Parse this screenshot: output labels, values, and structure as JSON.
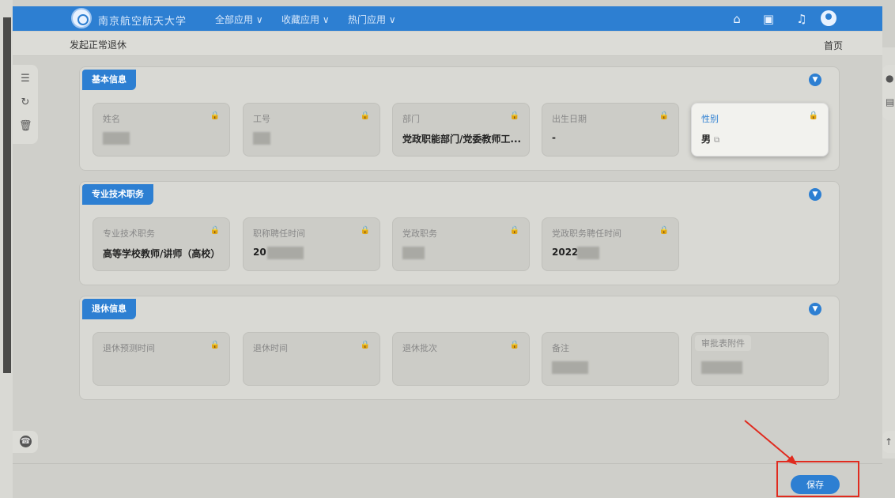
{
  "topbar": {
    "school_name": "南京航空航天大学",
    "menus": [
      "全部应用 ∨",
      "收藏应用 ∨",
      "热门应用 ∨"
    ],
    "colors": {
      "bar": "#2d7fd2"
    }
  },
  "header": {
    "title": "发起正常退休",
    "home": "首页"
  },
  "sections": {
    "basic": {
      "tag": "基本信息",
      "fields": [
        {
          "label": "姓名",
          "value": ""
        },
        {
          "label": "工号",
          "value": ""
        },
        {
          "label": "部门",
          "value": "党政职能部门/党委教师工..."
        },
        {
          "label": "出生日期",
          "value": "-"
        },
        {
          "label": "性别",
          "value": "男"
        }
      ]
    },
    "tech": {
      "tag": "专业技术职务",
      "fields": [
        {
          "label": "专业技术职务",
          "value": "高等学校教师/讲师（高校）"
        },
        {
          "label": "职称聘任时间",
          "value": "20"
        },
        {
          "label": "党政职务",
          "value": ""
        },
        {
          "label": "党政职务聘任时间",
          "value": "2022"
        }
      ]
    },
    "retire": {
      "tag": "退休信息",
      "fields": [
        {
          "label": "退休预测时间",
          "value": ""
        },
        {
          "label": "退休时间",
          "value": ""
        },
        {
          "label": "退休批次",
          "value": ""
        },
        {
          "label": "备注",
          "value": ""
        },
        {
          "label": "审批表附件",
          "value": ""
        }
      ]
    }
  },
  "footer": {
    "save_label": "保存"
  },
  "icons": [
    "list-icon",
    "refresh-icon",
    "trash-icon",
    "phone-icon",
    "lock-icon",
    "copy-icon",
    "chevron-down-icon",
    "home-icon",
    "bell-icon",
    "user-avatar-icon"
  ]
}
